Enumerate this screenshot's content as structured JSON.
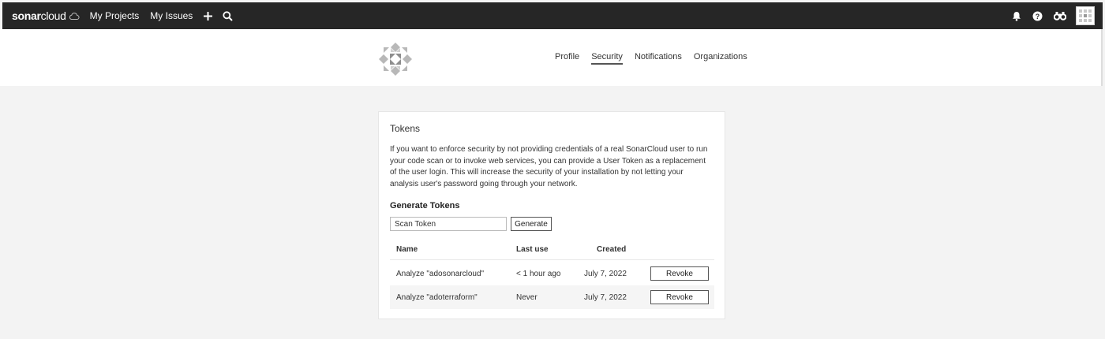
{
  "topbar": {
    "brand_bold": "sonar",
    "brand_light": "cloud",
    "nav": [
      "My Projects",
      "My Issues"
    ],
    "icons": [
      "cloud-icon",
      "plus-icon",
      "search-icon",
      "bell-icon",
      "help-icon",
      "binoculars-icon",
      "avatar"
    ]
  },
  "header": {
    "tabs": [
      "Profile",
      "Security",
      "Notifications",
      "Organizations"
    ],
    "active_tab": "Security"
  },
  "tokens": {
    "title": "Tokens",
    "description": "If you want to enforce security by not providing credentials of a real SonarCloud user to run your code scan or to invoke web services, you can provide a User Token as a replacement of the user login. This will increase the security of your installation by not letting your analysis user's password going through your network.",
    "generate_title": "Generate Tokens",
    "input_value": "Scan Token",
    "generate_label": "Generate",
    "columns": [
      "Name",
      "Last use",
      "Created"
    ],
    "rows": [
      {
        "name": "Analyze \"adosonarcloud\"",
        "last_use": "< 1 hour ago",
        "created": "July 7, 2022",
        "action": "Revoke"
      },
      {
        "name": "Analyze \"adoterraform\"",
        "last_use": "Never",
        "created": "July 7, 2022",
        "action": "Revoke"
      }
    ]
  },
  "colors": {
    "topbar_bg": "#262626",
    "page_bg": "#f3f3f3",
    "card_bg": "#ffffff"
  }
}
